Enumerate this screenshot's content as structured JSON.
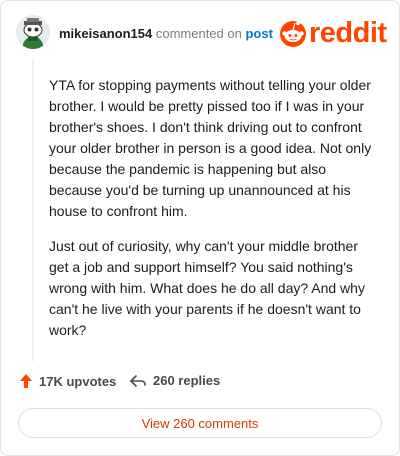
{
  "comment": {
    "author": "mikeisanon154",
    "action_text": "commented on",
    "target_link": "post",
    "paragraphs": [
      "YTA for stopping payments without telling your older brother. I would be pretty pissed too if I was in your brother's shoes. I don't think driving out to confront your older brother in person is a good idea. Not only because the pandemic is happening but also because you'd be turning up unannounced at his house to confront him.",
      "Just out of curiosity, why can't your middle brother get a job and support himself? You said nothing's wrong with him. What does he do all day? And why can't he live with your parents if he doesn't want to work?"
    ],
    "upvotes": "17K upvotes",
    "replies": "260 replies"
  },
  "brand": {
    "name": "reddit",
    "color": "#ff4500"
  },
  "view_button_label": "View 260 comments",
  "icons": {
    "avatar": "snoo-avatar-icon",
    "upvote": "upvote-arrow-icon",
    "reply": "reply-arrow-icon",
    "logo": "reddit-alien-icon"
  }
}
